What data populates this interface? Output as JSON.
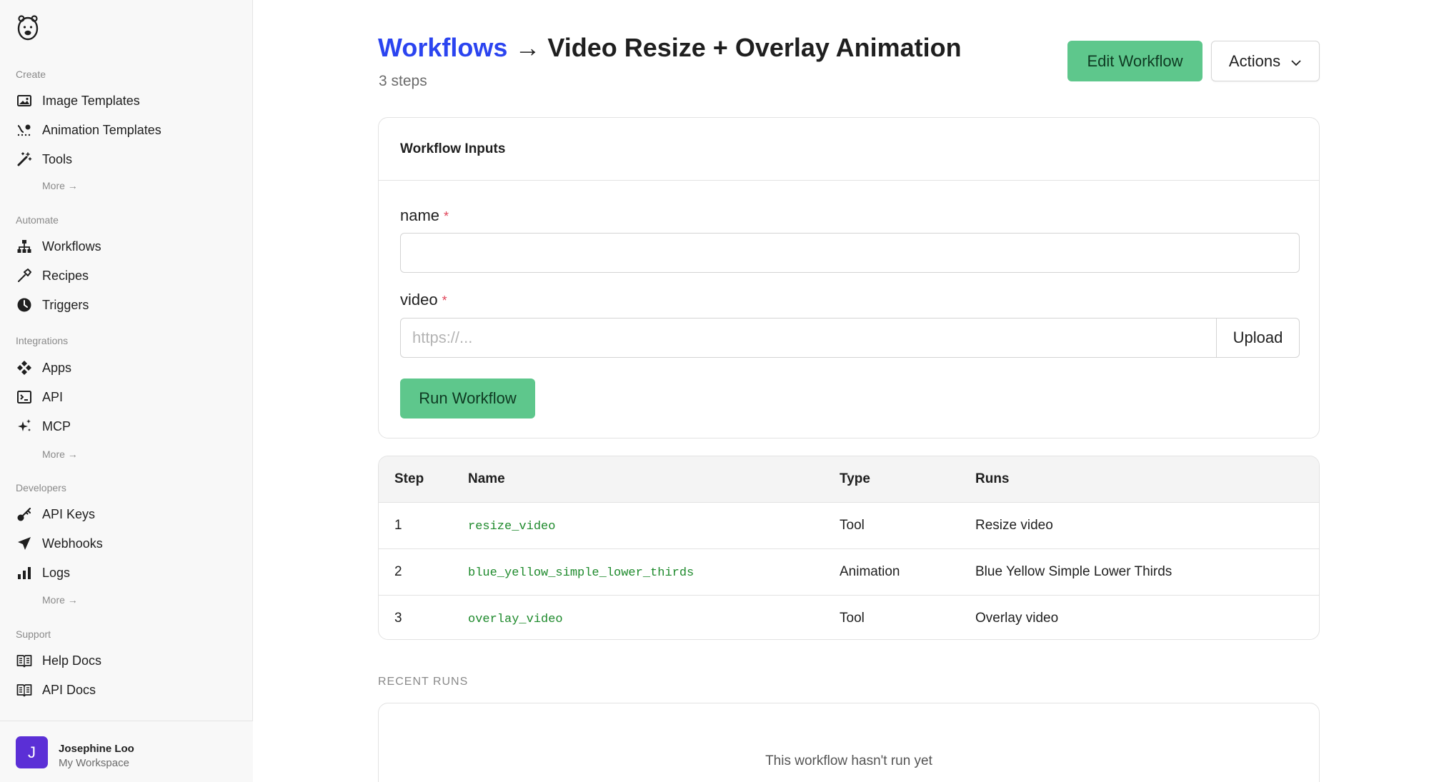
{
  "sidebar": {
    "sections": [
      {
        "title": "Create",
        "items": [
          {
            "label": "Image Templates",
            "icon": "image-icon"
          },
          {
            "label": "Animation Templates",
            "icon": "animation-icon"
          },
          {
            "label": "Tools",
            "icon": "magic-wand-icon"
          }
        ],
        "more": "More →"
      },
      {
        "title": "Automate",
        "items": [
          {
            "label": "Workflows",
            "icon": "sitemap-icon"
          },
          {
            "label": "Recipes",
            "icon": "pipette-icon"
          },
          {
            "label": "Triggers",
            "icon": "clock-icon"
          }
        ]
      },
      {
        "title": "Integrations",
        "items": [
          {
            "label": "Apps",
            "icon": "apps-icon"
          },
          {
            "label": "API",
            "icon": "terminal-icon"
          },
          {
            "label": "MCP",
            "icon": "sparkle-icon"
          }
        ],
        "more": "More →"
      },
      {
        "title": "Developers",
        "items": [
          {
            "label": "API Keys",
            "icon": "key-icon"
          },
          {
            "label": "Webhooks",
            "icon": "send-icon"
          },
          {
            "label": "Logs",
            "icon": "bar-chart-icon"
          }
        ],
        "more": "More →"
      },
      {
        "title": "Support",
        "items": [
          {
            "label": "Help Docs",
            "icon": "book-icon"
          },
          {
            "label": "API Docs",
            "icon": "book-icon"
          }
        ]
      }
    ],
    "user": {
      "initial": "J",
      "name": "Josephine Loo",
      "workspace": "My Workspace",
      "avatar_color": "#5b2fd6"
    }
  },
  "header": {
    "crumb_link": "Workflows",
    "crumb_arrow": "→",
    "title": "Video Resize + Overlay Animation",
    "subtitle": "3 steps",
    "edit_button": "Edit Workflow",
    "actions_button": "Actions"
  },
  "inputs": {
    "title": "Workflow Inputs",
    "required_mark": "*",
    "name_label": "name",
    "name_value": "",
    "video_label": "video",
    "video_placeholder": "https://...",
    "upload_button": "Upload",
    "run_button": "Run Workflow"
  },
  "steps": {
    "headers": {
      "step": "Step",
      "name": "Name",
      "type": "Type",
      "runs": "Runs"
    },
    "rows": [
      {
        "step": "1",
        "name": "resize_video",
        "type": "Tool",
        "runs": "Resize video"
      },
      {
        "step": "2",
        "name": "blue_yellow_simple_lower_thirds",
        "type": "Animation",
        "runs": "Blue Yellow Simple Lower Thirds"
      },
      {
        "step": "3",
        "name": "overlay_video",
        "type": "Tool",
        "runs": "Overlay video"
      }
    ]
  },
  "recent": {
    "title": "RECENT RUNS",
    "empty": "This workflow hasn't run yet"
  },
  "colors": {
    "accent_green": "#5ec78c",
    "link_blue": "#2b44f0",
    "code_green": "#1e8a2c",
    "required_red": "#e0455a"
  }
}
